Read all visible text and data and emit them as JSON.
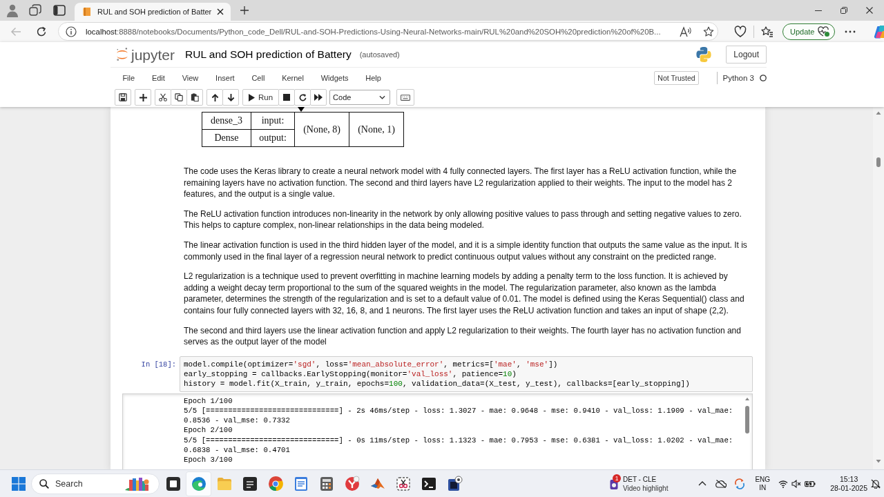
{
  "browser": {
    "tabs": [
      {
        "title": "RUL and SOH prediction of Batter",
        "selected": true
      }
    ],
    "back_disabled": true,
    "url_host": "localhost",
    "url_path": ":8888/notebooks/Documents/Python_code_Dell/RUL-and-SOH-Predictions-Using-Neural-Networks-main/RUL%20and%20SOH%20prediction%20of%20B...",
    "update_button": "Update"
  },
  "jupyter": {
    "logo_text": "jupyter",
    "notebook_title": "RUL and SOH prediction of Battery",
    "save_status": "(autosaved)",
    "logout_button": "Logout",
    "menu": [
      "File",
      "Edit",
      "View",
      "Insert",
      "Cell",
      "Kernel",
      "Widgets",
      "Help"
    ],
    "trust_button": "Not Trusted",
    "kernel_name": "Python 3",
    "kernel_busy": false,
    "toolbar": {
      "run_button": "Run",
      "cell_type": "Code"
    }
  },
  "notebook": {
    "model_plot": {
      "layer_name": "dense_3",
      "layer_type": "Dense",
      "port_labels": [
        "input:",
        "output:"
      ],
      "input_shape": "(None, 8)",
      "output_shape": "(None, 1)"
    },
    "markdown": [
      "The code uses the Keras library to create a neural network model with 4 fully connected layers. The first layer has a ReLU activation function, while the remaining layers have no activation function. The second and third layers have L2 regularization applied to their weights. The input to the model has 2 features, and the output is a single value.",
      "The ReLU activation function introduces non-linearity in the network by only allowing positive values to pass through and setting negative values to zero. This helps to capture complex, non-linear relationships in the data being modeled.",
      "The linear activation function is used in the third hidden layer of the model, and it is a simple identity function that outputs the same value as the input. It is commonly used in the final layer of a regression neural network to predict continuous output values without any constraint on the predicted range.",
      "L2 regularization is a technique used to prevent overfitting in machine learning models by adding a penalty term to the loss function. It is achieved by adding a weight decay term proportional to the sum of the squared weights in the model. The regularization parameter, also known as the lambda parameter, determines the strength of the regularization and is set to a default value of 0.01. The model is defined using the Keras Sequential() class and contains four fully connected layers with 32, 16, 8, and 1 neurons. The first layer uses the ReLU activation function and takes an input of shape (2,2).",
      "The second and third layers use the linear activation function and apply L2 regularization to their weights. The fourth layer has no activation function and serves as the output layer of the model"
    ],
    "code_cell": {
      "prompt": "In [18]:",
      "lines": [
        "model.compile(optimizer='sgd', loss='mean_absolute_error', metrics=['mae', 'mse'])",
        "early_stopping = callbacks.EarlyStopping(monitor='val_loss', patience=10)",
        "history = model.fit(X_train, y_train, epochs=100, validation_data=(X_test, y_test), callbacks=[early_stopping])"
      ]
    },
    "output_lines": [
      "Epoch 1/100",
      "5/5 [==============================] - 2s 46ms/step - loss: 1.3027 - mae: 0.9648 - mse: 0.9410 - val_loss: 1.1909 - val_mae:",
      "0.8536 - val_mse: 0.7332",
      "Epoch 2/100",
      "5/5 [==============================] - 0s 11ms/step - loss: 1.1323 - mae: 0.7953 - mse: 0.6381 - val_loss: 1.0202 - val_mae:",
      "0.6838 - val_mse: 0.4701",
      "Epoch 3/100"
    ]
  },
  "taskbar": {
    "search": {
      "placeholder": "Search"
    },
    "apps": [
      {
        "kind": "window",
        "selected": false
      },
      {
        "kind": "edge",
        "selected": true
      },
      {
        "kind": "folder",
        "selected": false
      },
      {
        "kind": "notes",
        "selected": false
      },
      {
        "kind": "chrome",
        "selected": false
      },
      {
        "kind": "notepad",
        "selected": false
      },
      {
        "kind": "calculator",
        "selected": false
      },
      {
        "kind": "round",
        "selected": false
      },
      {
        "kind": "peak",
        "selected": false
      },
      {
        "kind": "snip",
        "selected": false
      },
      {
        "kind": "terminal",
        "selected": false
      },
      {
        "kind": "app",
        "selected": false
      }
    ],
    "widget": {
      "badge": "1",
      "title": "DET - CLE",
      "subtitle": "Video highlight"
    },
    "language": "ENG",
    "region": "IN",
    "time": "15:13",
    "date": "28-01-2025"
  }
}
